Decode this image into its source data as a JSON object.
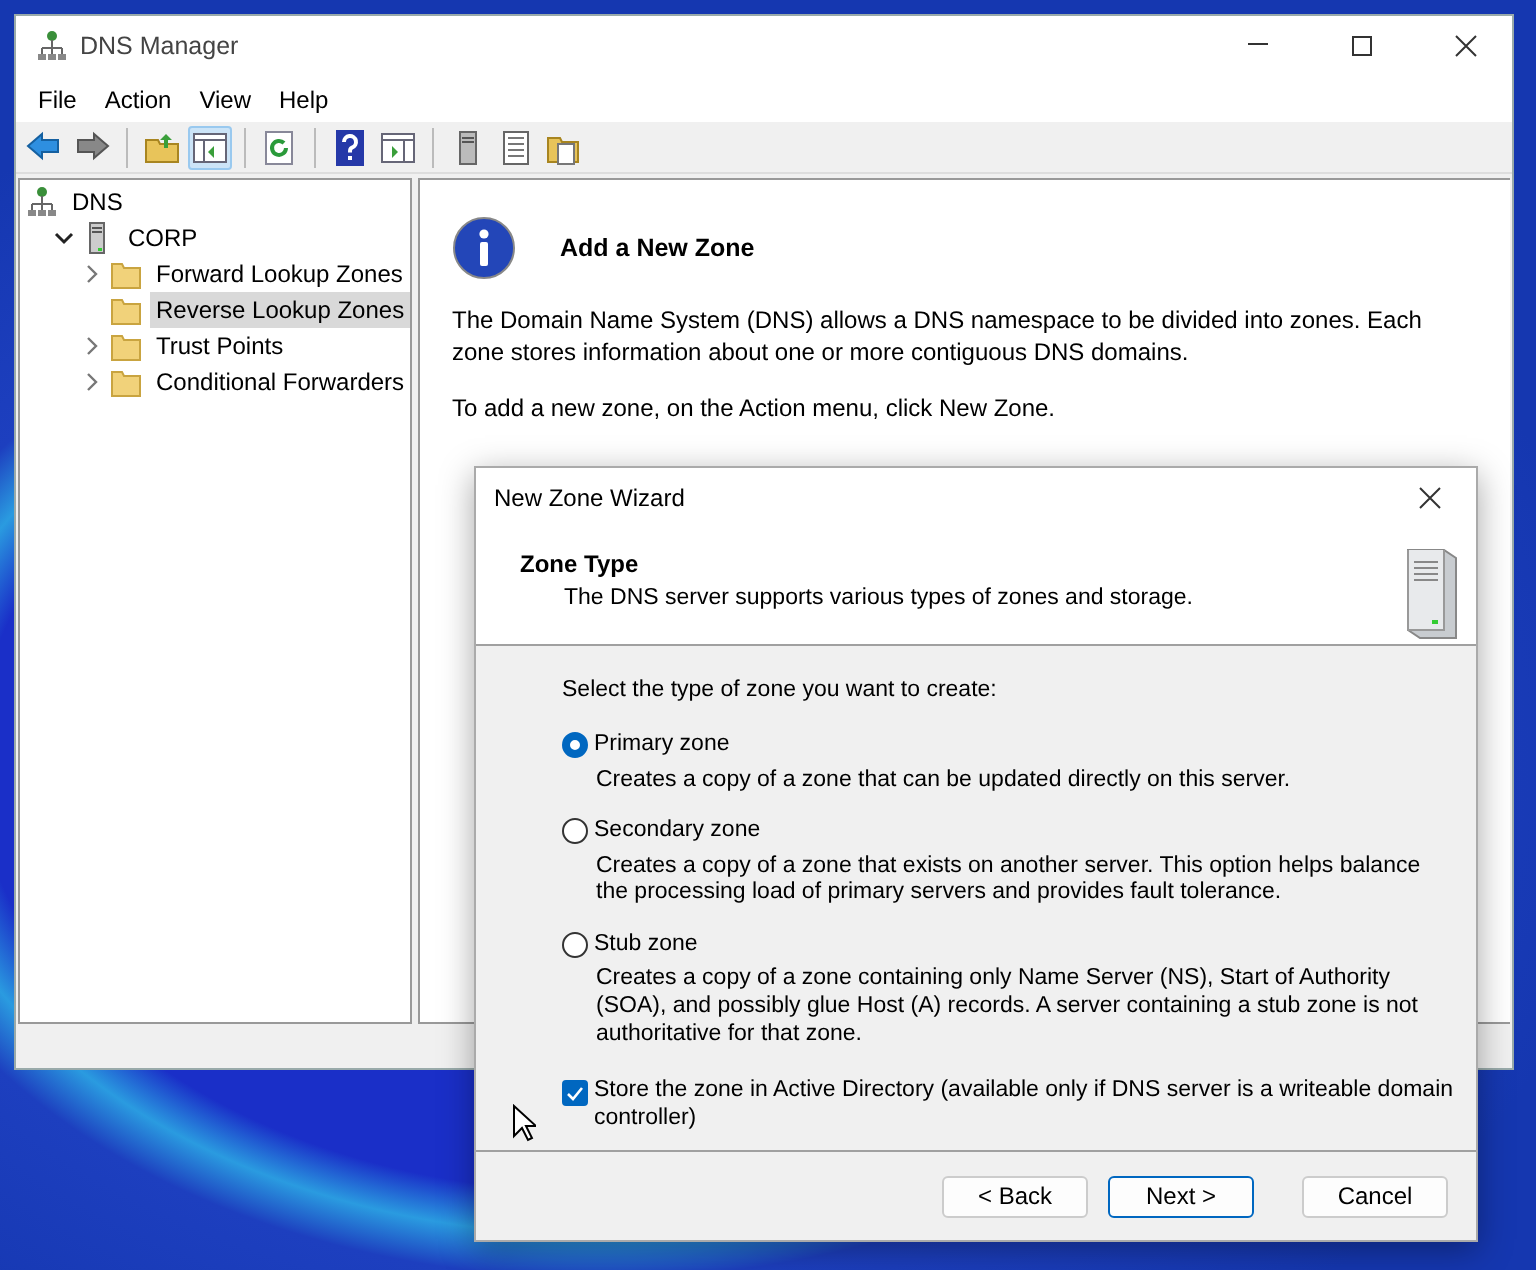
{
  "main_window": {
    "title": "DNS Manager",
    "menu": [
      "File",
      "Action",
      "View",
      "Help"
    ],
    "toolbar_groups": [
      [
        {
          "kind": "back"
        },
        {
          "kind": "forward"
        }
      ],
      [
        {
          "kind": "up"
        },
        {
          "kind": "tree-toggle",
          "pressed": true
        }
      ],
      [
        {
          "kind": "refresh"
        }
      ],
      [
        {
          "kind": "help"
        },
        {
          "kind": "action-pane"
        }
      ],
      [
        {
          "kind": "server"
        },
        {
          "kind": "list"
        },
        {
          "kind": "new-folder"
        }
      ]
    ],
    "tree": [
      {
        "label": "DNS",
        "kind": "root",
        "selected": false,
        "children": [
          {
            "label": "CORP",
            "kind": "server",
            "expanded": true,
            "selected": false,
            "children": [
              {
                "label": "Forward Lookup Zones",
                "kind": "folder",
                "expanded": false,
                "selected": false
              },
              {
                "label": "Reverse Lookup Zones",
                "kind": "folder",
                "selected": true
              },
              {
                "label": "Trust Points",
                "kind": "folder",
                "expanded": false,
                "selected": false
              },
              {
                "label": "Conditional Forwarders",
                "kind": "folder",
                "expanded": false,
                "selected": false
              }
            ]
          }
        ]
      }
    ],
    "details": {
      "heading": "Add a New Zone",
      "paragraphs": [
        "The Domain Name System (DNS) allows a DNS namespace to be divided into zones. Each zone stores information about one or more contiguous DNS domains.",
        "To add a new zone, on the Action menu, click New Zone."
      ]
    }
  },
  "wizard": {
    "title": "New Zone Wizard",
    "header_title": "Zone Type",
    "header_subtitle": "The DNS server supports various types of zones and storage.",
    "prompt": "Select the type of zone you want to create:",
    "options": [
      {
        "label": "Primary zone",
        "description": "Creates a copy of a zone that can be updated directly on this server.",
        "selected": true
      },
      {
        "label": "Secondary zone",
        "description": "Creates a copy of a zone that exists on another server. This option helps balance the processing load of primary servers and provides fault tolerance.",
        "selected": false
      },
      {
        "label": "Stub zone",
        "description": "Creates a copy of a zone containing only Name Server (NS), Start of Authority (SOA), and possibly glue Host (A) records. A server containing a stub zone is not authoritative for that zone.",
        "selected": false
      }
    ],
    "store_in_ad": {
      "label": "Store the zone in Active Directory (available only if DNS server is a writeable domain controller)",
      "checked": true
    },
    "buttons": [
      {
        "label": "< Back",
        "default": false
      },
      {
        "label": "Next >",
        "default": true
      },
      {
        "label": "Cancel",
        "default": false
      }
    ]
  }
}
